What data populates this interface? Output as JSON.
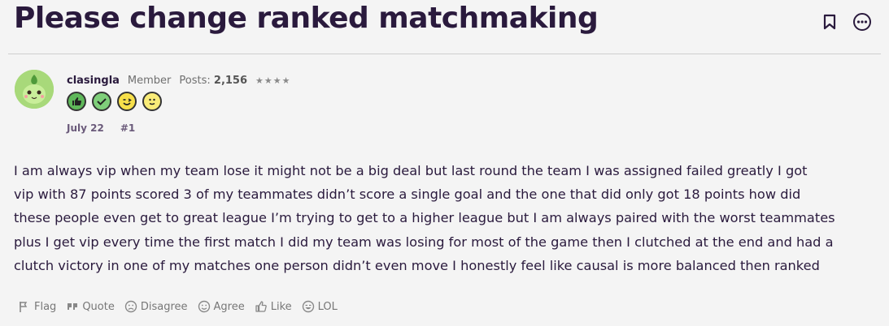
{
  "thread": {
    "title": "Please change ranked matchmaking"
  },
  "post": {
    "author": "clasingla",
    "role": "Member",
    "posts_label": "Posts:",
    "posts_count": "2,156",
    "stars": "★★★★",
    "badges": [
      "thumbs-up-badge",
      "check-badge",
      "wink-badge",
      "smile-badge"
    ],
    "date": "July 22",
    "number": "#1",
    "body_lines": [
      "I am always vip when my team lose it might not be a big deal but last round the team I was assigned failed greatly I got",
      "vip with 87 points scored 3 of my teammates didn’t score a single goal and the one that did only got 18 points how did",
      "these people even get to great league I’m trying to get to a higher league but I am always paired with the worst teammates",
      "plus I get vip every time the first match I did my team was losing for most of the game then I clutched at the end and had a",
      "clutch victory in one of my matches one person didn’t even move I honestly feel like causal is more balanced then ranked"
    ]
  },
  "reactions": {
    "flag": "Flag",
    "quote": "Quote",
    "disagree": "Disagree",
    "agree": "Agree",
    "like": "Like",
    "lol": "LOL"
  }
}
